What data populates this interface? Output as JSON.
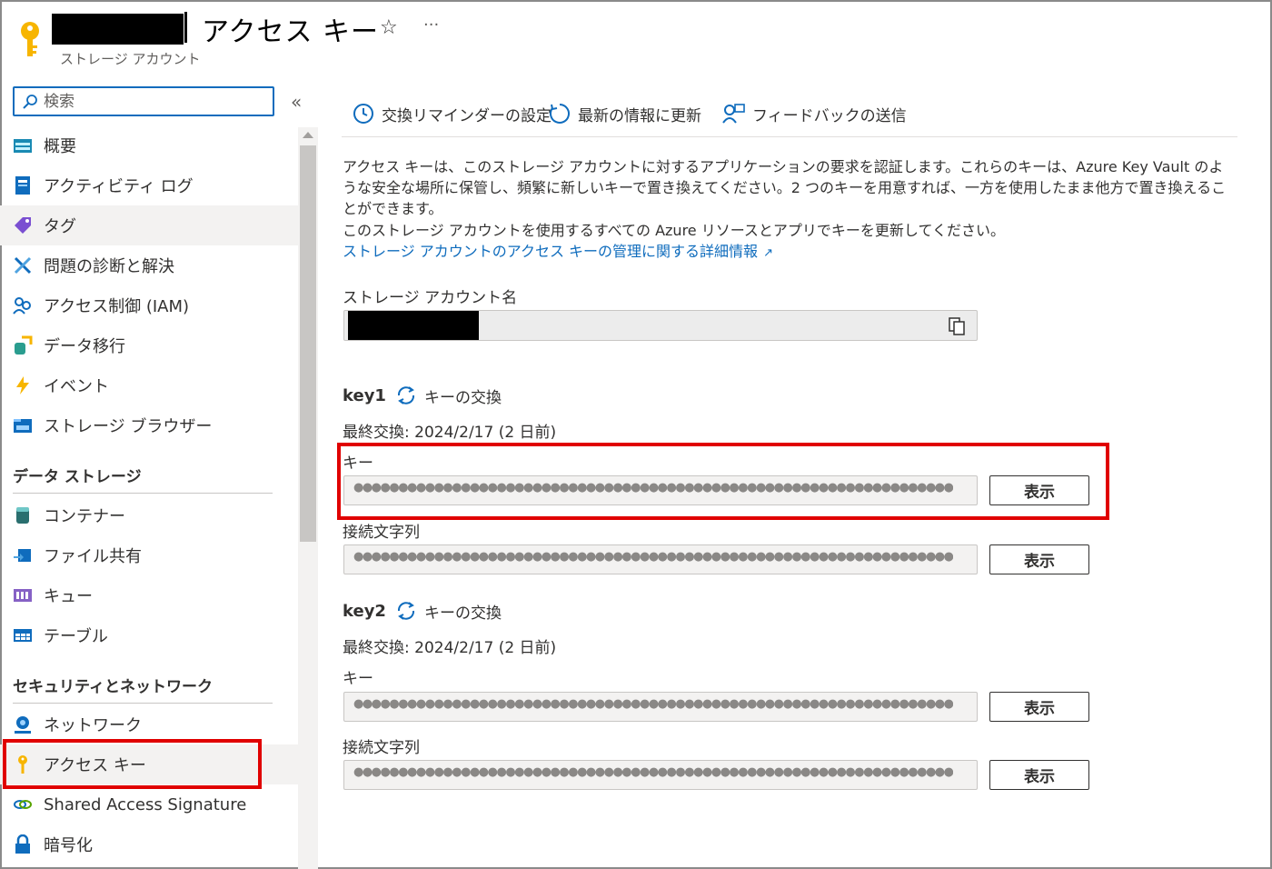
{
  "header": {
    "title": "アクセス キー",
    "subtitle": "ストレージ アカウント",
    "star_icon": "☆",
    "more_icon": "···",
    "icon": "key-icon"
  },
  "sidebar": {
    "search_placeholder": "検索",
    "collapse_icon": "«",
    "items": [
      {
        "label": "概要",
        "icon": "overview-icon"
      },
      {
        "label": "アクティビティ ログ",
        "icon": "activity-log-icon"
      },
      {
        "label": "タグ",
        "icon": "tag-icon"
      },
      {
        "label": "問題の診断と解決",
        "icon": "wrench-icon"
      },
      {
        "label": "アクセス制御 (IAM)",
        "icon": "people-icon"
      },
      {
        "label": "データ移行",
        "icon": "data-migration-icon"
      },
      {
        "label": "イベント",
        "icon": "lightning-icon"
      },
      {
        "label": "ストレージ ブラウザー",
        "icon": "storage-browser-icon"
      }
    ],
    "section_data_storage": "データ ストレージ",
    "data_storage_items": [
      {
        "label": "コンテナー",
        "icon": "container-icon"
      },
      {
        "label": "ファイル共有",
        "icon": "file-share-icon"
      },
      {
        "label": "キュー",
        "icon": "queue-icon"
      },
      {
        "label": "テーブル",
        "icon": "table-icon"
      }
    ],
    "section_security": "セキュリティとネットワーク",
    "security_items": [
      {
        "label": "ネットワーク",
        "icon": "network-icon"
      },
      {
        "label": "アクセス キー",
        "icon": "key-icon"
      },
      {
        "label": "Shared Access Signature",
        "icon": "link-icon"
      },
      {
        "label": "暗号化",
        "icon": "lock-icon"
      }
    ]
  },
  "toolbar": {
    "reminder": "交換リマインダーの設定",
    "refresh": "最新の情報に更新",
    "feedback": "フィードバックの送信"
  },
  "content": {
    "description": "アクセス キーは、このストレージ アカウントに対するアプリケーションの要求を認証します。これらのキーは、Azure Key Vault のような安全な場所に保管し、頻繁に新しいキーで置き換えてください。2 つのキーを用意すれば、一方を使用したまま他方で置き換えることができます。",
    "description2": "このストレージ アカウントを使用するすべての Azure リソースとアプリでキーを更新してください。",
    "learn_more": "ストレージ アカウントのアクセス キーの管理に関する詳細情報",
    "external_icon": "↗",
    "account_name_label": "ストレージ アカウント名",
    "key_label": "キー",
    "conn_label": "接続文字列",
    "show_label": "表示",
    "rotate_label": "キーの交換",
    "masked_value": "●●●●●●●●●●●●●●●●●●●●●●●●●●●●●●●●●●●●●●●●●●●●●●●●●●●●●●●●●●●●●●●●●●●●●●●●●●●●●●●●●●···",
    "key1": {
      "name": "key1",
      "last_rotated": "最終交換: 2024/2/17 (2 日前)"
    },
    "key2": {
      "name": "key2",
      "last_rotated": "最終交換: 2024/2/17 (2 日前)"
    }
  },
  "colors": {
    "accent": "#0f6cbd",
    "highlight": "#e00000",
    "key_yellow": "#f7b500"
  }
}
